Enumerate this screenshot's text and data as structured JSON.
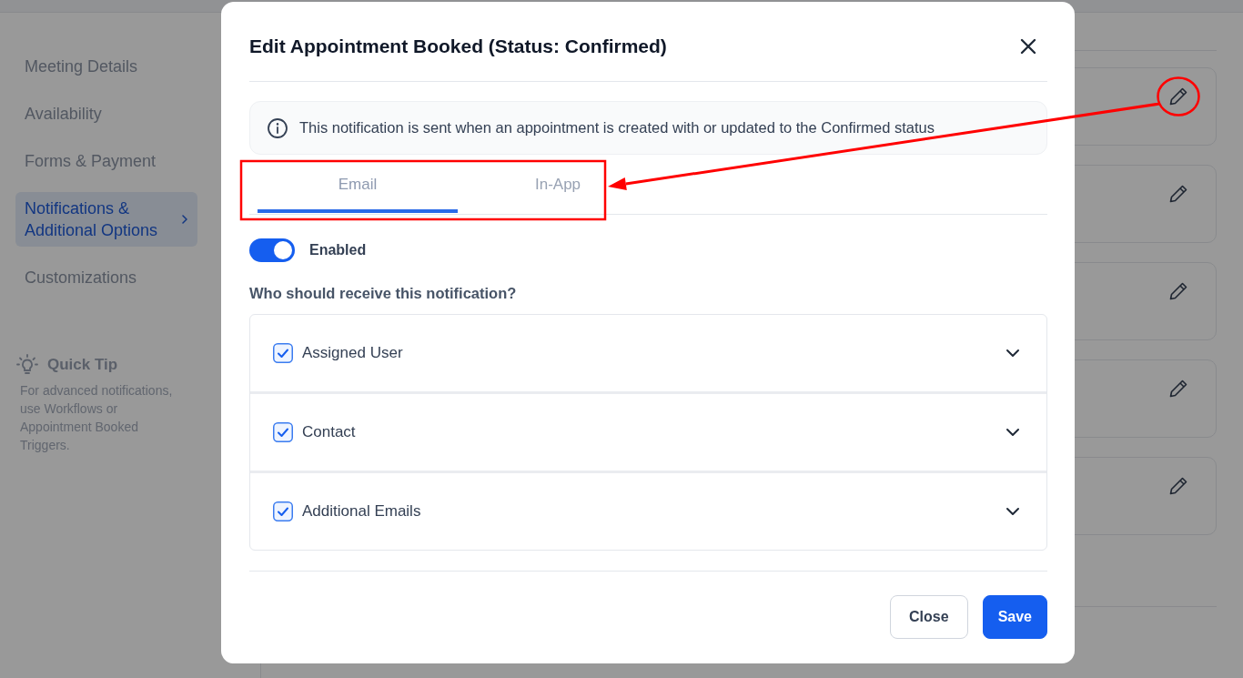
{
  "sidebar": {
    "items": [
      {
        "label": "Meeting Details",
        "selected": false
      },
      {
        "label": "Availability",
        "selected": false
      },
      {
        "label": "Forms & Payment",
        "selected": false
      },
      {
        "label": "Notifications & Additional Options",
        "selected": true
      },
      {
        "label": "Customizations",
        "selected": false
      }
    ],
    "quick_tip": {
      "title": "Quick Tip",
      "text": "For advanced notifications, use Workflows or Appointment Booked Triggers."
    }
  },
  "cards": [
    {
      "edit_circled": true
    },
    {
      "edit_circled": false
    },
    {
      "edit_circled": false
    },
    {
      "edit_circled": false
    },
    {
      "edit_circled": false
    }
  ],
  "modal": {
    "title": "Edit Appointment Booked (Status: Confirmed)",
    "info": "This notification is sent when an appointment is created with or updated to the Confirmed status",
    "tab_bar": {
      "highlighted": true,
      "tabs": [
        {
          "label": "Email",
          "selected": true
        },
        {
          "label": "In-App",
          "selected": false
        }
      ]
    },
    "enabled": {
      "label": "Enabled",
      "on": true
    },
    "recipients_heading": "Who should receive this notification?",
    "recipients": [
      {
        "label": "Assigned User",
        "checked": true,
        "expanded": false
      },
      {
        "label": "Contact",
        "checked": true,
        "expanded": false
      },
      {
        "label": "Additional Emails",
        "checked": true,
        "expanded": false
      }
    ],
    "buttons": [
      {
        "label": "Close",
        "kind": "secondary"
      },
      {
        "label": "Save",
        "kind": "primary"
      }
    ]
  }
}
